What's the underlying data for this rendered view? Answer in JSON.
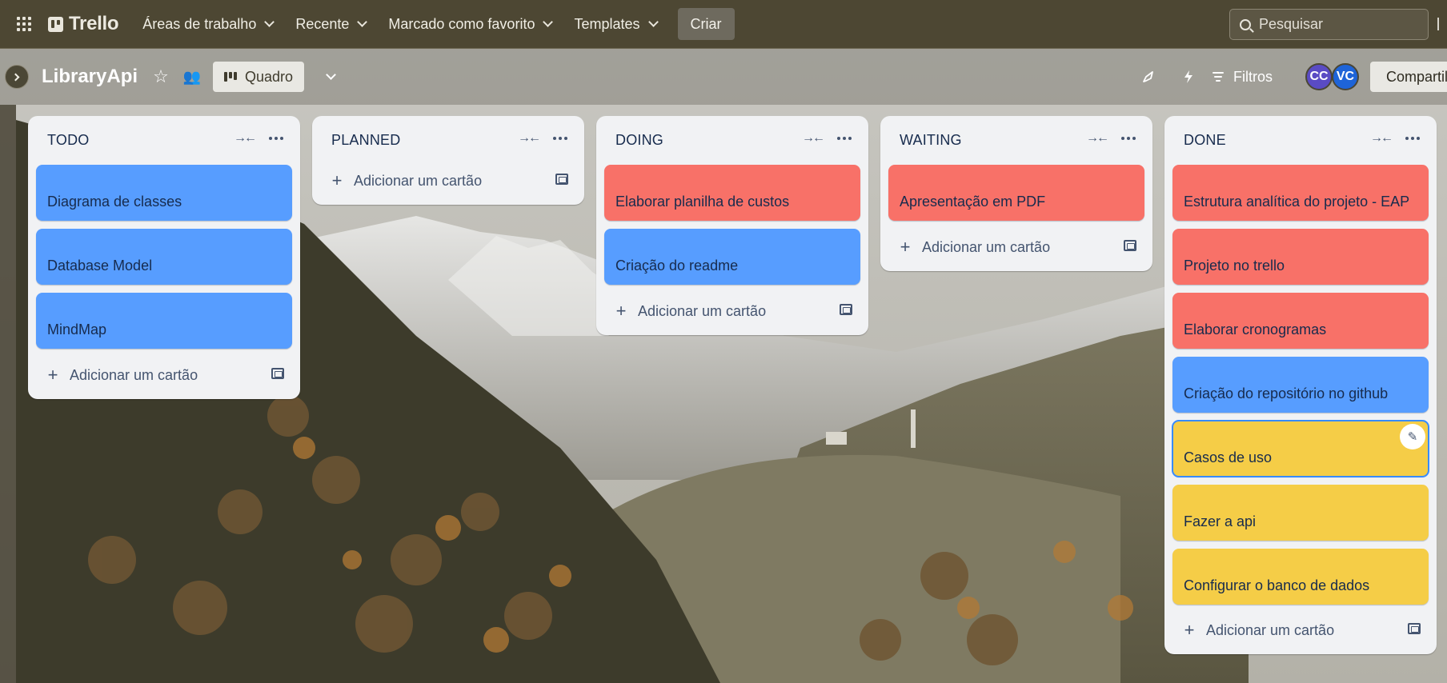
{
  "nav": {
    "brand": "Trello",
    "items": [
      {
        "label": "Áreas de trabalho"
      },
      {
        "label": "Recente"
      },
      {
        "label": "Marcado como favorito"
      },
      {
        "label": "Templates"
      }
    ],
    "create_label": "Criar",
    "search_placeholder": "Pesquisar"
  },
  "board": {
    "title": "LibraryApi",
    "view_label": "Quadro",
    "filters_label": "Filtros",
    "share_label": "Compartilhar",
    "members": [
      {
        "initials": "CC",
        "color": "#5a4bc4"
      },
      {
        "initials": "VC",
        "color": "#1e64d8"
      }
    ]
  },
  "colors": {
    "card_blue": "#579dff",
    "card_red": "#f87168",
    "card_yellow": "#f5cd47",
    "list_bg": "#f1f2f4",
    "topbar_bg": "#4d4733"
  },
  "add_card_label": "Adicionar um cartão",
  "lists": [
    {
      "title": "TODO",
      "cards": [
        {
          "title": "Diagrama de classes",
          "color": "blue"
        },
        {
          "title": "Database Model",
          "color": "blue"
        },
        {
          "title": "MindMap",
          "color": "blue"
        }
      ]
    },
    {
      "title": "PLANNED",
      "cards": []
    },
    {
      "title": "DOING",
      "cards": [
        {
          "title": "Elaborar planilha de custos",
          "color": "red"
        },
        {
          "title": "Criação do readme",
          "color": "blue"
        }
      ]
    },
    {
      "title": "WAITING",
      "cards": [
        {
          "title": "Apresentação em PDF",
          "color": "red"
        }
      ]
    },
    {
      "title": "DONE",
      "cards": [
        {
          "title": "Estrutura analítica do projeto - EAP",
          "color": "red"
        },
        {
          "title": "Projeto no trello",
          "color": "red"
        },
        {
          "title": "Elaborar cronogramas",
          "color": "red"
        },
        {
          "title": "Criação do repositório no github",
          "color": "blue"
        },
        {
          "title": "Casos de uso",
          "color": "yellow"
        },
        {
          "title": "Fazer a api",
          "color": "yellow"
        },
        {
          "title": "Configurar o banco de dados",
          "color": "yellow"
        }
      ]
    }
  ]
}
